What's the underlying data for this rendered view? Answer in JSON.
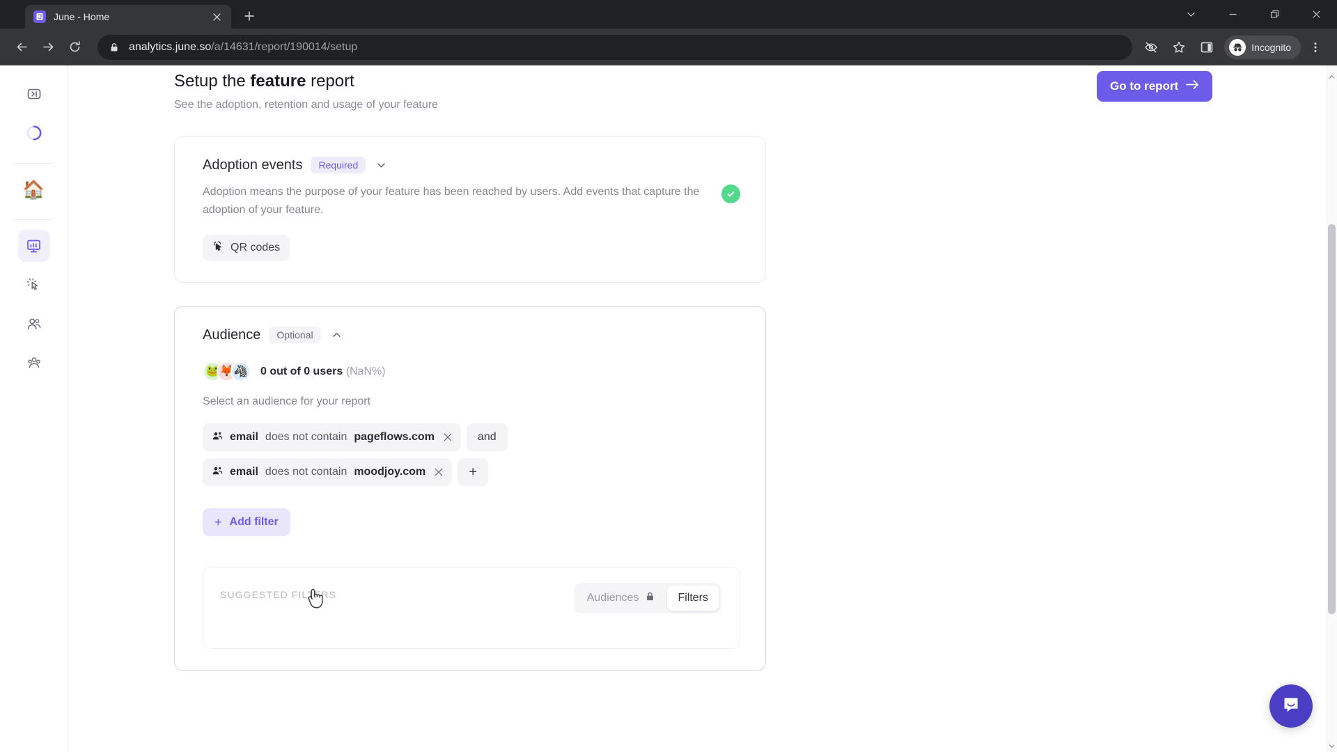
{
  "browser": {
    "tab": {
      "title": "June - Home",
      "favicon_icon": "june-logo-icon",
      "close_icon": "close-icon"
    },
    "newtab_icon": "plus-icon",
    "window_controls": [
      {
        "name": "tab-search",
        "icon": "chevron-down-icon"
      },
      {
        "name": "minimize",
        "icon": "minimize-icon"
      },
      {
        "name": "maximize",
        "icon": "restore-icon"
      },
      {
        "name": "close",
        "icon": "close-icon"
      }
    ],
    "nav": {
      "back_icon": "back-arrow-icon",
      "forward_icon": "forward-arrow-icon",
      "reload_icon": "reload-icon"
    },
    "omnibox": {
      "lock_icon": "lock-icon",
      "url_domain": "analytics.june.so",
      "url_path": "/a/14631/report/190014/setup"
    },
    "toolbar_icons": [
      {
        "name": "third-party-cookies-blocked-icon",
        "glyph": "eye-slash-icon"
      },
      {
        "name": "bookmark-star-icon",
        "glyph": "star-icon"
      },
      {
        "name": "side-panel-icon",
        "glyph": "panel-icon"
      }
    ],
    "profile": {
      "label": "Incognito",
      "icon": "incognito-icon"
    },
    "menu_icon": "three-dot-menu-icon"
  },
  "sidebar": {
    "items": [
      {
        "name": "expand-sidebar",
        "icon": "expand-panel-icon",
        "active": false
      },
      {
        "name": "workspace-loading",
        "icon": "loading-spinner-icon",
        "active": false
      },
      {
        "name": "home",
        "icon": "house-emoji",
        "emoji": "🏠",
        "active": false
      },
      {
        "name": "reports",
        "icon": "presentation-chart-icon",
        "active": true
      },
      {
        "name": "events",
        "icon": "cursor-click-icon",
        "active": false
      },
      {
        "name": "users",
        "icon": "users-icon",
        "active": false
      },
      {
        "name": "companies",
        "icon": "group-people-icon",
        "active": false
      }
    ]
  },
  "header": {
    "title_prefix": "Setup the ",
    "title_bold": "feature",
    "title_suffix": " report",
    "subtitle": "See the adoption, retention and usage of your feature",
    "go_to_report_label": "Go to report",
    "go_to_report_icon": "arrow-right-icon"
  },
  "adoption_card": {
    "title": "Adoption events",
    "badge": "Required",
    "collapse_icon": "chevron-down-icon",
    "description": "Adoption means the purpose of your feature has been reached by users. Add events that capture the adoption of your feature.",
    "status_icon": "check-circle-icon",
    "status_color": "#53d98b",
    "event_chip": {
      "label": "QR codes",
      "icon": "cursor-click-icon"
    }
  },
  "audience_card": {
    "title": "Audience",
    "badge": "Optional",
    "collapse_icon": "chevron-up-icon",
    "avatars": [
      {
        "emoji": "🐸",
        "bg": "#d9f2d0"
      },
      {
        "emoji": "🦊",
        "bg": "#fcdada"
      },
      {
        "emoji": "🦓",
        "bg": "#d6ecf8"
      }
    ],
    "count_bold": "0 out of 0 users",
    "count_muted": "(NaN%)",
    "helper_text": "Select an audience for your report",
    "filters": [
      {
        "icon": "users-icon",
        "property": "email",
        "operator": "does not contain",
        "value": "pageflows.com",
        "remove_icon": "close-icon",
        "trailing": {
          "type": "conjunction",
          "label": "and"
        }
      },
      {
        "icon": "users-icon",
        "property": "email",
        "operator": "does not contain",
        "value": "moodjoy.com",
        "remove_icon": "close-icon",
        "trailing": {
          "type": "add",
          "label": "+"
        }
      }
    ],
    "add_filter": {
      "label": "Add filter",
      "plus": "+"
    },
    "suggested": {
      "title": "SUGGESTED FILTERS",
      "tabs": [
        {
          "label": "Audiences",
          "selected": false,
          "icon": "lock-icon"
        },
        {
          "label": "Filters",
          "selected": true,
          "icon": null
        }
      ]
    }
  },
  "intercom": {
    "icon": "intercom-chat-icon",
    "color": "#4a3fc4"
  },
  "cursor": {
    "icon": "pointer-hand-cursor"
  },
  "colors": {
    "accent": "#6c5ce7",
    "accent_soft": "#e9e6fb",
    "success": "#53d98b"
  }
}
